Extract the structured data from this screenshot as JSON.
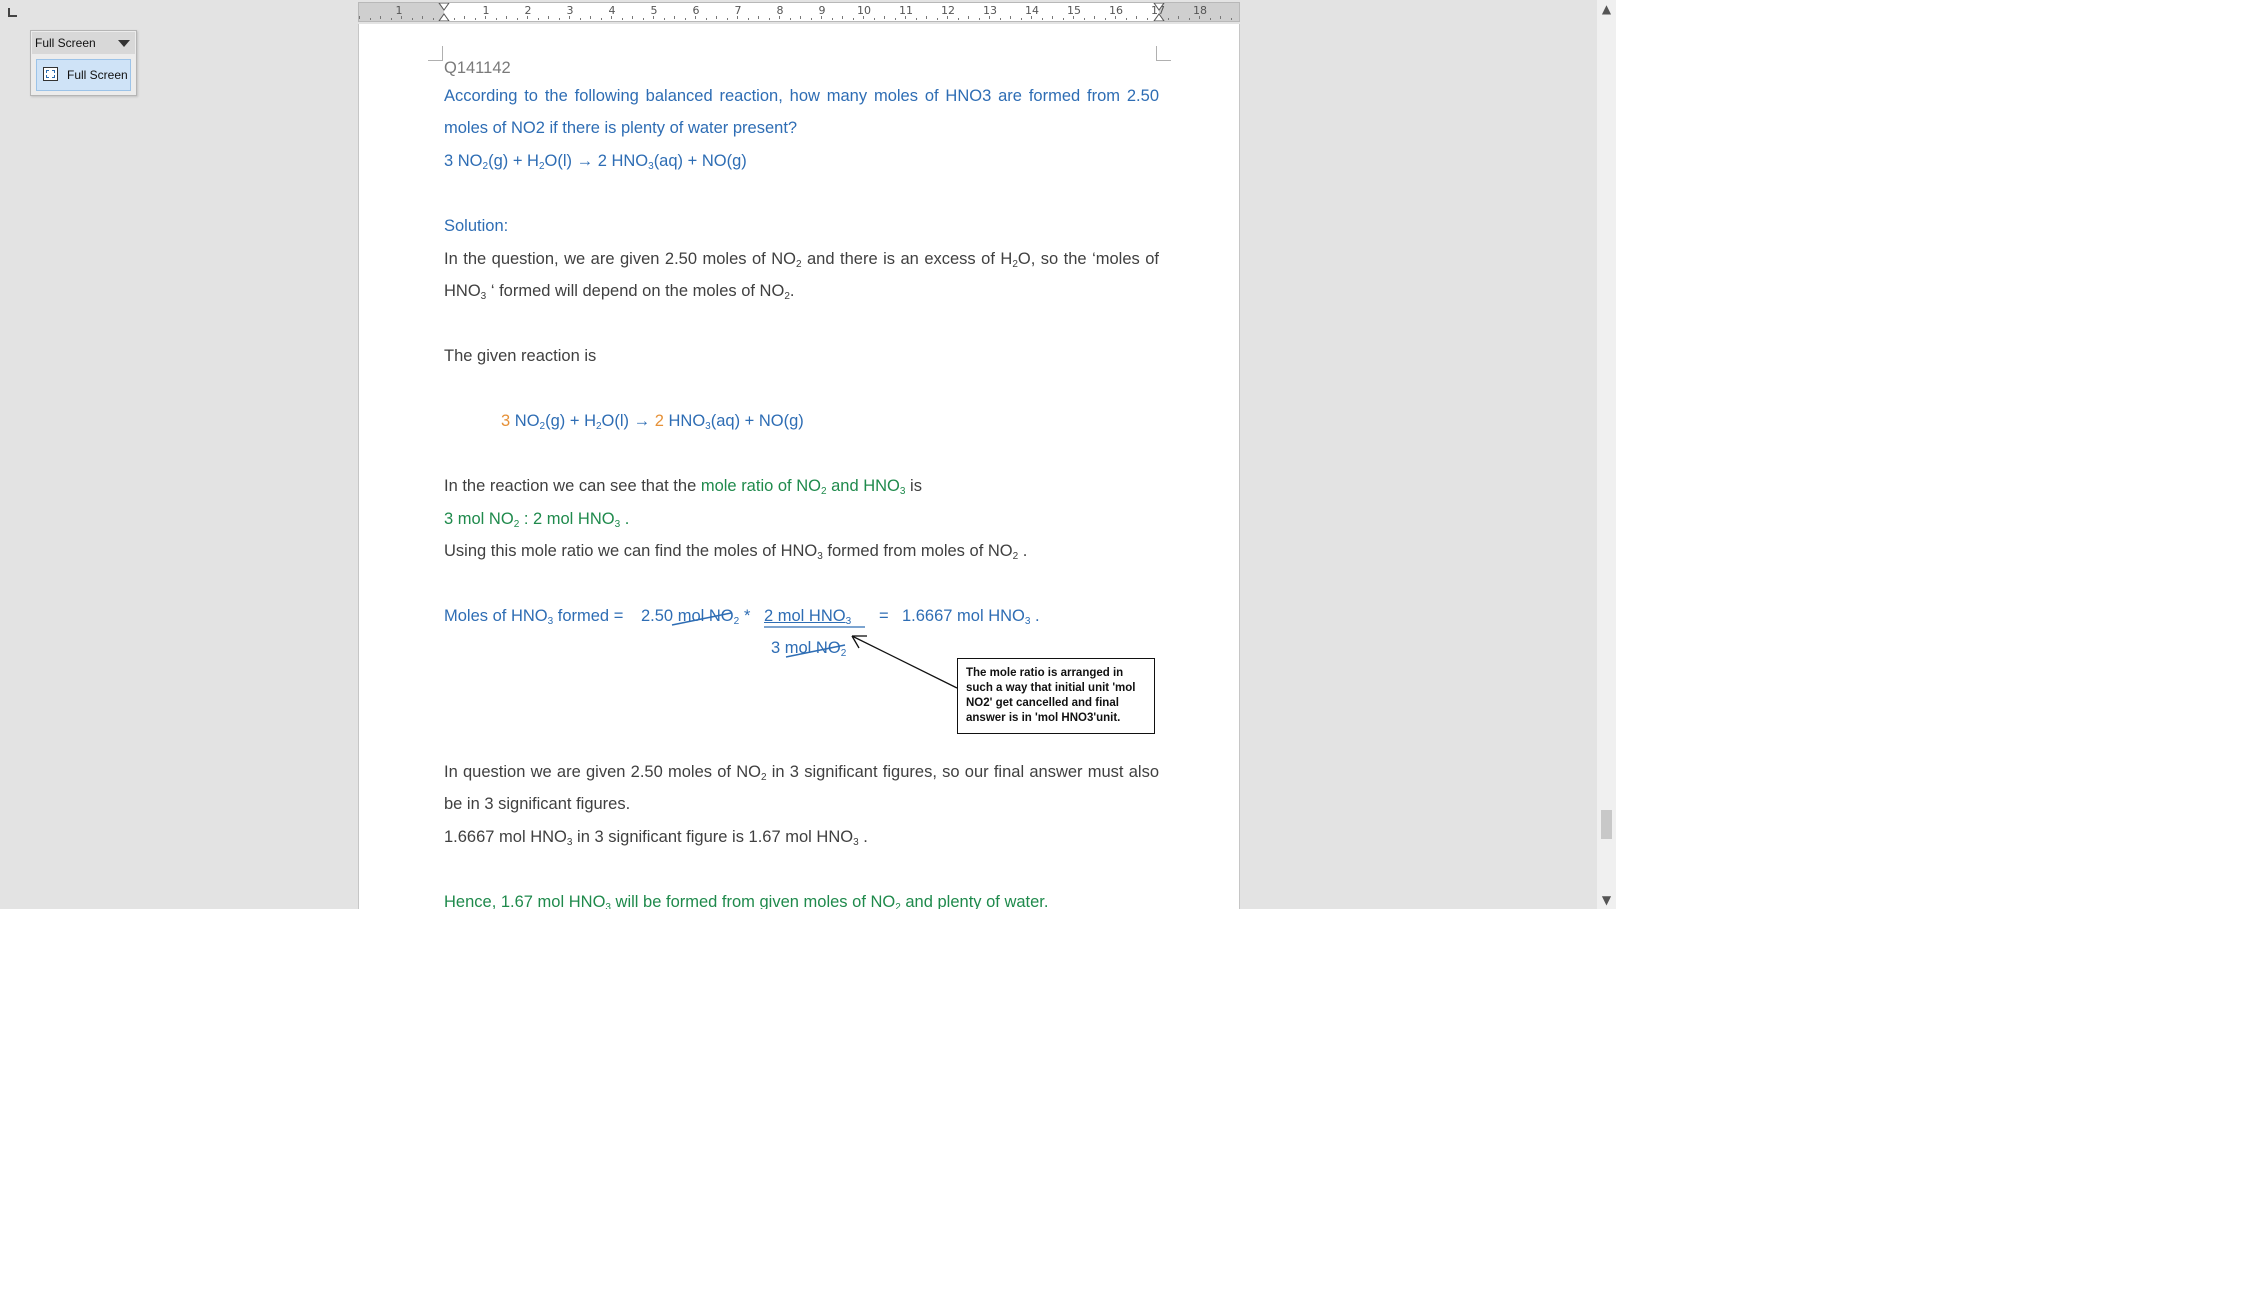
{
  "toolbar": {
    "title": "Full Screen",
    "button_label": "Full Screen"
  },
  "ruler": {
    "numbers": [
      "1",
      "1",
      "2",
      "3",
      "4",
      "5",
      "6",
      "7",
      "8",
      "9",
      "10",
      "11",
      "12",
      "13",
      "14",
      "15",
      "16",
      "17",
      "18"
    ]
  },
  "document": {
    "question_id": "Q141142",
    "q_line1": "According to the following balanced reaction, how many moles of HNO3 are formed from 2.50",
    "q_line2": "moles of NO2 if there is plenty of water present?",
    "eq1": {
      "a": "3 NO",
      "b": "(g) + H",
      "c": "O(l) → 2 HNO",
      "d": "(aq) + NO(g)"
    },
    "solution_label": "Solution:",
    "p1_a": "In the question, we are given 2.50 moles of NO",
    "p1_b": " and there is an excess of H",
    "p1_c": "O,  so the ‘moles of",
    "p2_a": "HNO",
    "p2_b": " ‘ formed will depend on the moles of NO",
    "p2_c": ".",
    "given_reaction": "The given reaction is",
    "eq2": {
      "coef1": "3",
      "a": " NO",
      "b": "(g) + H",
      "c": "O(l) →  ",
      "coef2": "2",
      "d": " HNO",
      "e": "(aq) + NO(g)"
    },
    "ratio_a": "In the reaction we can see that the ",
    "ratio_b": "mole ratio of NO",
    "ratio_c": " and  HNO",
    "ratio_d": "  is",
    "ratio_line": {
      "a": "3 mol NO",
      "b": " : 2 mol HNO",
      "c": " ."
    },
    "using_a": "Using this mole ratio we can find the moles of HNO",
    "using_b": " formed from moles of NO",
    "using_c": " .",
    "calc": {
      "label_a": "Moles of HNO",
      "label_b": " formed  =",
      "v1": "2.50 mol NO",
      "times": "*",
      "num": "2 mol HNO",
      "equals": "=",
      "result": "1.6667 mol HNO",
      "dot": " .",
      "den": "3 mol NO"
    },
    "callout": "The mole ratio is arranged in such a way that initial unit 'mol NO2' get cancelled and final answer is in 'mol HNO3'unit.",
    "sig_a": "In question we are given  2.50 moles of  NO",
    "sig_b": " in 3 significant figures,  so our final answer must also",
    "sig_line2": "be in 3 significant figures.",
    "round_a": "1.6667 mol HNO",
    "round_b": "  in 3 significant figure is  1.67 mol HNO",
    "round_c": " .",
    "final_a": "Hence,  1.67 mol HNO",
    "final_b": " will be formed from  given  moles of NO",
    "final_c": " and plenty of water.",
    "sub2": "2",
    "sub3": "3"
  },
  "colors": {
    "blue": "#2e6db4",
    "green": "#1f8a4c",
    "orange": "#e69138",
    "body": "#404040"
  }
}
